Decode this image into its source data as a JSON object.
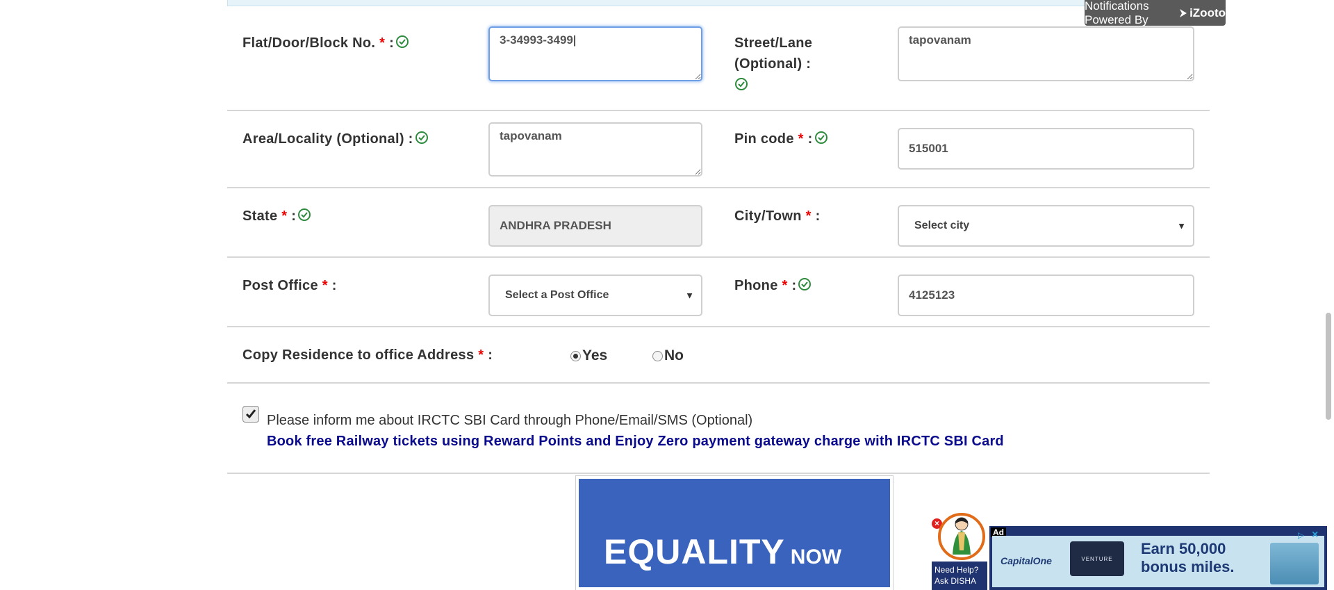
{
  "notification": {
    "prefix": "Notifications Powered By",
    "brand": "iZooto"
  },
  "form": {
    "flat": {
      "label": "Flat/Door/Block No.",
      "suffix": ":",
      "value": "3-34993-3499"
    },
    "street": {
      "label_line1": "Street/Lane",
      "label_line2": "(Optional) :",
      "value": "tapovanam"
    },
    "area": {
      "label": "Area/Locality (Optional) :",
      "value": "tapovanam"
    },
    "pincode": {
      "label": "Pin code",
      "suffix": ":",
      "value": "515001"
    },
    "state": {
      "label": "State",
      "suffix": ":",
      "value": "ANDHRA PRADESH"
    },
    "city": {
      "label": "City/Town",
      "suffix": ":",
      "selected": "Select city"
    },
    "post_office": {
      "label": "Post Office",
      "suffix": ":",
      "selected": "Select a Post Office"
    },
    "phone": {
      "label": "Phone",
      "suffix": ":",
      "value": "4125123"
    },
    "copy_address": {
      "label": "Copy Residence to office Address",
      "suffix": ":",
      "yes": "Yes",
      "no": "No",
      "selected": "Yes"
    },
    "sbi": {
      "checkbox_text": "Please inform me about IRCTC SBI Card through Phone/Email/SMS (Optional)",
      "promo": "Book free Railway tickets using Reward Points and Enjoy Zero payment gateway charge with IRCTC SBI Card",
      "checked": true
    },
    "required_mark": "*"
  },
  "banner": {
    "text_big": "EQUALITY",
    "text_small": "NOW"
  },
  "disha": {
    "line1": "Need Help?",
    "line2": "Ask DISHA"
  },
  "ad": {
    "badge": "Ad",
    "brand": "CapitalOne",
    "card": "VENTURE",
    "line1": "Earn 50,000",
    "line2": "bonus miles."
  },
  "colors": {
    "required": "#ee0000",
    "check_green": "#2e8b3e",
    "promo_blue": "#0a0a8c",
    "banner_blue": "#3a63bd"
  }
}
